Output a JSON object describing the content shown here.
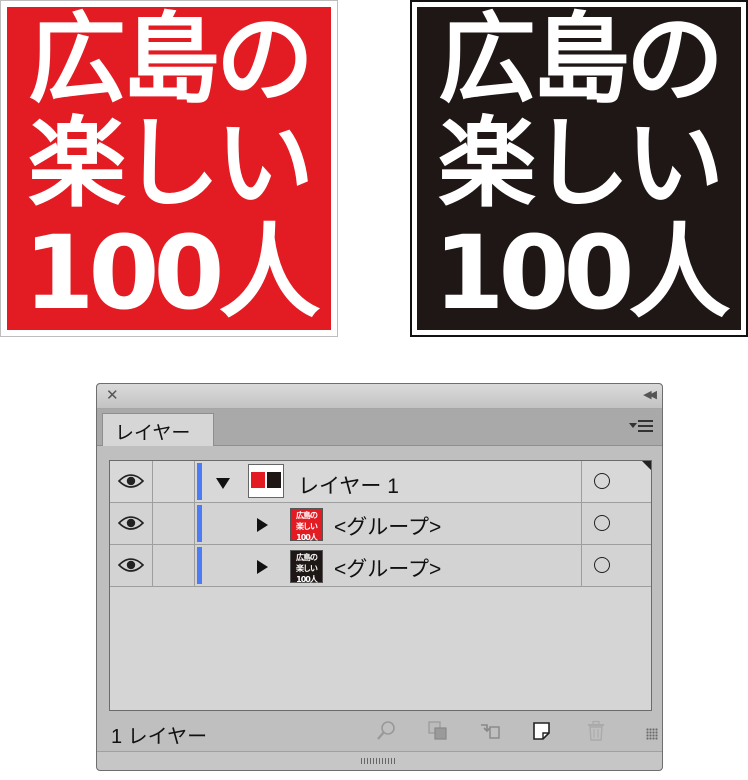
{
  "artwork": {
    "red": {
      "line1": "広島の",
      "line2": "楽しい",
      "line3": "100人",
      "bg": "#e31b23"
    },
    "black": {
      "line1": "広島の",
      "line2": "楽しい",
      "line3": "100人",
      "bg": "#1e1716"
    },
    "text_color": "#ffffff"
  },
  "panel": {
    "tab_label": "レイヤー",
    "rows": [
      {
        "label": "レイヤー 1",
        "type": "layer",
        "expanded": true
      },
      {
        "label": "<グループ>",
        "type": "group",
        "expanded": false,
        "thumb": "red"
      },
      {
        "label": "<グループ>",
        "type": "group",
        "expanded": false,
        "thumb": "black"
      }
    ],
    "footer": {
      "count_label": "1 レイヤー"
    },
    "layer_color": "#4b7cf6"
  }
}
